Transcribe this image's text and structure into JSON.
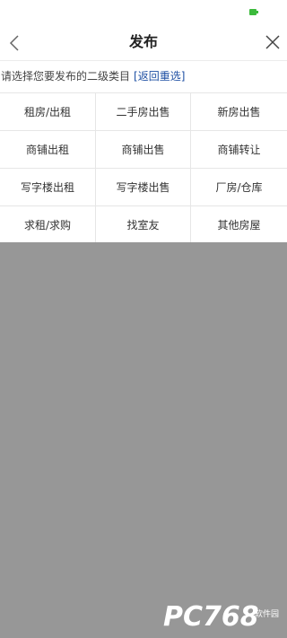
{
  "navbar": {
    "title": "发布"
  },
  "prompt": {
    "text": "请选择您要发布的二级类目",
    "reset_label": "[返回重选]"
  },
  "categories": [
    "租房/出租",
    "二手房出售",
    "新房出售",
    "商铺出租",
    "商铺出售",
    "商铺转让",
    "写字楼出租",
    "写字楼出售",
    "厂房/仓库",
    "求租/求购",
    "找室友",
    "其他房屋"
  ],
  "watermark": {
    "brand": "PC768",
    "sub": "软件园"
  },
  "colors": {
    "link": "#1e4fa3",
    "overlay": "#979797",
    "battery": "#3cba3c"
  }
}
